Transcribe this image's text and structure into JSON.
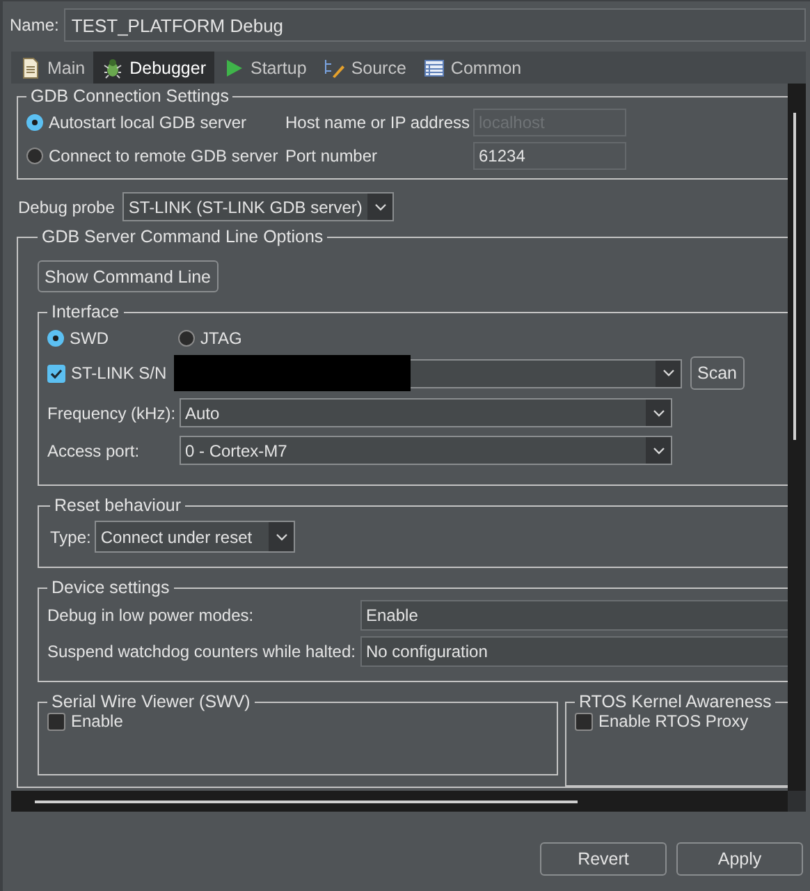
{
  "name_field": {
    "label": "Name:",
    "value": "TEST_PLATFORM Debug"
  },
  "tabs": [
    {
      "label": "Main",
      "kind": "document",
      "selected": false
    },
    {
      "label": "Debugger",
      "kind": "bug",
      "selected": true
    },
    {
      "label": "Startup",
      "kind": "play",
      "selected": false
    },
    {
      "label": "Source",
      "kind": "source",
      "selected": false
    },
    {
      "label": "Common",
      "kind": "table",
      "selected": false
    }
  ],
  "gdb_connection": {
    "title": "GDB Connection Settings",
    "options": [
      {
        "label": "Autostart local GDB server",
        "selected": true
      },
      {
        "label": "Connect to remote GDB server",
        "selected": false
      }
    ],
    "fields": [
      {
        "label": "Host name or IP address",
        "value": "localhost",
        "disabled": true
      },
      {
        "label": "Port number",
        "value": "61234",
        "disabled": false
      }
    ]
  },
  "debug_probe": {
    "label": "Debug probe",
    "value": "ST-LINK (ST-LINK GDB server)"
  },
  "gdb_server_options": {
    "title": "GDB Server Command Line Options",
    "button": "Show Command Line",
    "interface": {
      "title": "Interface",
      "modes": [
        {
          "label": "SWD",
          "selected": true
        },
        {
          "label": "JTAG",
          "selected": false
        }
      ],
      "serial": {
        "label": "ST-LINK S/N",
        "checked": true,
        "redacted": true
      },
      "scan_button": "Scan",
      "fields": [
        {
          "label": "Frequency (kHz):",
          "value": "Auto"
        },
        {
          "label": "Access port:",
          "value": "0 - Cortex-M7"
        }
      ]
    },
    "reset": {
      "title": "Reset behaviour",
      "label": "Type:",
      "value": "Connect under reset"
    },
    "device_settings": {
      "title": "Device settings",
      "fields": [
        {
          "label": "Debug in low power modes:",
          "value": "Enable"
        },
        {
          "label": "Suspend watchdog counters while halted:",
          "value": "No configuration"
        }
      ]
    },
    "swv": {
      "title": "Serial Wire Viewer (SWV)",
      "option": {
        "label": "Enable",
        "checked": false
      }
    },
    "rtos": {
      "title": "RTOS Kernel Awareness",
      "option": {
        "label": "Enable RTOS Proxy",
        "checked": false
      }
    }
  },
  "buttons": [
    {
      "label": "Revert"
    },
    {
      "label": "Apply"
    }
  ]
}
